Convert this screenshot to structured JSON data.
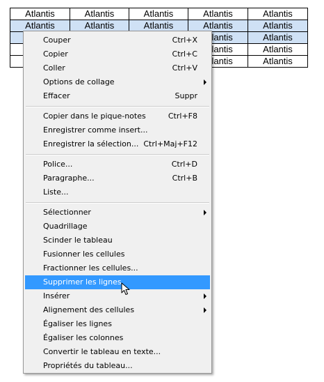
{
  "table": {
    "rows": [
      [
        "Atlantis",
        "Atlantis",
        "Atlantis",
        "Atlantis",
        "Atlantis"
      ],
      [
        "Atlantis",
        "Atlantis",
        "Atlantis",
        "Atlantis",
        "Atlantis"
      ],
      [
        "",
        "",
        "",
        "Atlantis",
        "Atlantis"
      ],
      [
        "",
        "",
        "",
        "Atlantis",
        "Atlantis"
      ],
      [
        "",
        "",
        "",
        "Atlantis",
        "Atlantis"
      ]
    ],
    "selected_rows": [
      1,
      2
    ]
  },
  "menu": {
    "items": [
      {
        "label": "Couper",
        "shortcut": "Ctrl+X"
      },
      {
        "label": "Copier",
        "shortcut": "Ctrl+C"
      },
      {
        "label": "Coller",
        "shortcut": "Ctrl+V"
      },
      {
        "label": "Options de collage",
        "shortcut": "",
        "submenu": true
      },
      {
        "label": "Effacer",
        "shortcut": "Suppr"
      },
      {
        "label": "Copier dans le pique-notes",
        "shortcut": "Ctrl+F8"
      },
      {
        "label": "Enregistrer comme insert...",
        "shortcut": ""
      },
      {
        "label": "Enregistrer la sélection...",
        "shortcut": "Ctrl+Maj+F12"
      },
      {
        "label": "Police...",
        "shortcut": "Ctrl+D"
      },
      {
        "label": "Paragraphe...",
        "shortcut": "Ctrl+B"
      },
      {
        "label": "Liste...",
        "shortcut": ""
      },
      {
        "label": "Sélectionner",
        "shortcut": "",
        "submenu": true
      },
      {
        "label": "Quadrillage",
        "shortcut": ""
      },
      {
        "label": "Scinder le tableau",
        "shortcut": ""
      },
      {
        "label": "Fusionner les cellules",
        "shortcut": ""
      },
      {
        "label": "Fractionner les cellules...",
        "shortcut": ""
      },
      {
        "label": "Supprimer les lignes",
        "shortcut": "",
        "highlighted": true
      },
      {
        "label": "Insérer",
        "shortcut": "",
        "submenu": true
      },
      {
        "label": "Alignement des cellules",
        "shortcut": "",
        "submenu": true
      },
      {
        "label": "Égaliser les lignes",
        "shortcut": ""
      },
      {
        "label": "Égaliser les colonnes",
        "shortcut": ""
      },
      {
        "label": "Convertir le tableau en texte...",
        "shortcut": ""
      },
      {
        "label": "Propriétés du tableau...",
        "shortcut": ""
      }
    ]
  },
  "colors": {
    "highlight": "#3399ff",
    "selection": "#cfe1f5",
    "menu_bg": "#f0f0f0"
  }
}
